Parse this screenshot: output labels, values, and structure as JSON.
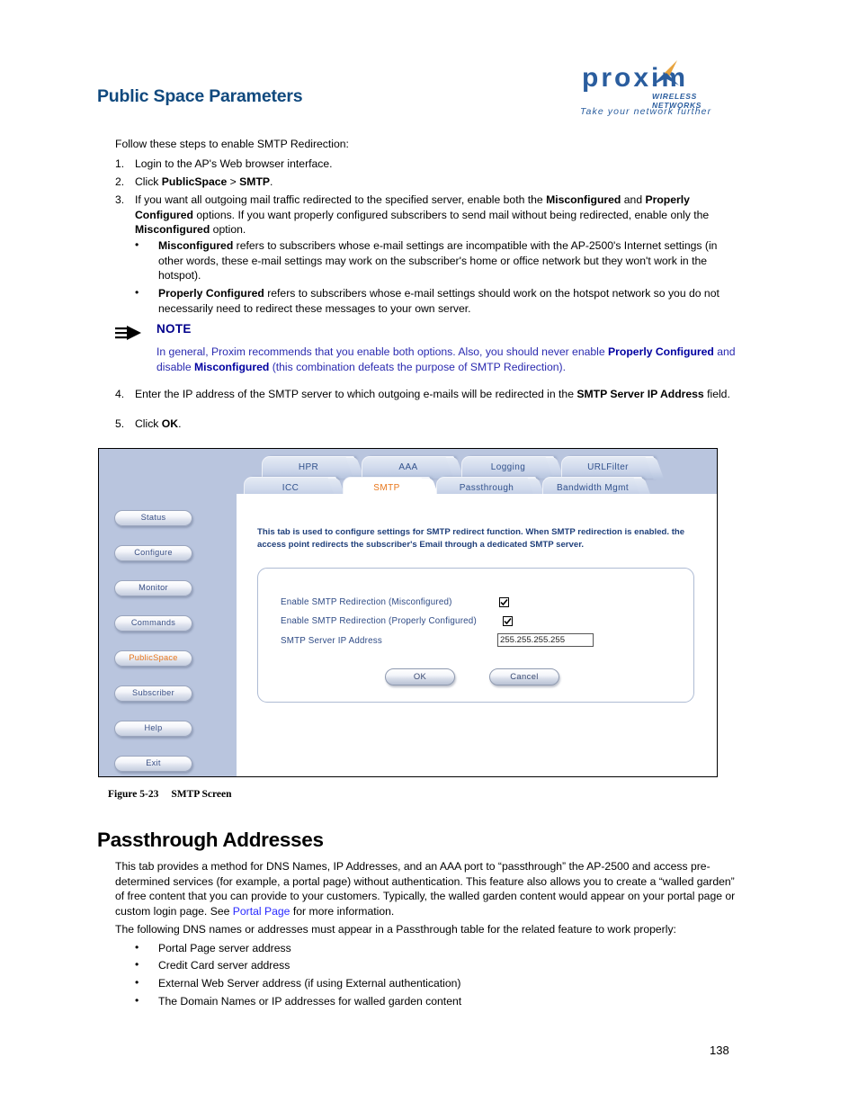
{
  "header": {
    "title": "Public Space Parameters",
    "logo": {
      "wordmark": "proxim",
      "subtitle": "WIRELESS NETWORKS",
      "tagline": "Take your network further",
      "brand_color": "#2a5d9e",
      "accent_color": "#e8a33d"
    }
  },
  "doc": {
    "intro": "Follow these steps to enable SMTP Redirection:",
    "steps": [
      {
        "num": "1.",
        "html": "Login to the AP's Web browser interface."
      },
      {
        "num": "2.",
        "html": "Click <b>PublicSpace</b> &gt; <b>SMTP</b>."
      },
      {
        "num": "3.",
        "html": "If you want all outgoing mail traffic redirected to the specified server, enable both the <b>Misconfigured</b> and <b>Properly Configured</b> options. If you want properly configured subscribers to send mail without being redirected, enable only the <b>Misconfigured</b> option."
      },
      {
        "num": "4.",
        "html": "Enter the IP address of the SMTP server to which outgoing e-mails will be redirected in the <b>SMTP Server IP Address</b> field."
      },
      {
        "num": "5.",
        "html": "Click <b>OK</b>."
      }
    ],
    "sub_bullets": [
      {
        "marker": "•",
        "html": "<b>Misconfigured</b> refers to subscribers whose e-mail settings are incompatible with the AP-2500's Internet settings (in other words, these e-mail settings may work on the subscriber's home or office network but they won't work in the hotspot)."
      },
      {
        "marker": "•",
        "html": "<b>Properly Configured</b> refers to subscribers whose e-mail settings should work on the hotspot network so you do not necessarily need to redirect these messages to your own server."
      }
    ],
    "note": {
      "label": "NOTE",
      "icon": "note-arrow-icon",
      "html": "In general, Proxim recommends that you enable both options. Also, you should never enable <b>Properly Configured</b> and disable <b>Misconfigured</b> (this combination defeats the purpose of SMTP Redirection).",
      "text_color": "#2a2ab0"
    }
  },
  "figure": {
    "caption_label": "Figure 5-23",
    "caption_text": "SMTP Screen",
    "sidebar": {
      "items": [
        {
          "label": "Status",
          "active": false
        },
        {
          "label": "Configure",
          "active": false
        },
        {
          "label": "Monitor",
          "active": false
        },
        {
          "label": "Commands",
          "active": false
        },
        {
          "label": "PublicSpace",
          "active": true
        },
        {
          "label": "Subscriber",
          "active": false
        },
        {
          "label": "Help",
          "active": false
        },
        {
          "label": "Exit",
          "active": false
        }
      ],
      "background_color": "#b9c5de",
      "active_color": "#e8761b"
    },
    "tabs_row1": [
      {
        "label": "HPR",
        "active": false
      },
      {
        "label": "AAA",
        "active": false
      },
      {
        "label": "Logging",
        "active": false
      },
      {
        "label": "URLFilter",
        "active": false
      }
    ],
    "tabs_row2": [
      {
        "label": "ICC",
        "active": false
      },
      {
        "label": "SMTP",
        "active": true
      },
      {
        "label": "Passthrough",
        "active": false
      },
      {
        "label": "Bandwidth Mgmt",
        "active": false
      }
    ],
    "description": "This tab is used to configure settings for SMTP redirect function. When SMTP redirection is enabled. the access point redirects the subscriber's Email through a dedicated SMTP server.",
    "form": {
      "fields": [
        {
          "label": "Enable SMTP Redirection (Misconfigured)",
          "type": "checkbox",
          "checked": true
        },
        {
          "label": "Enable SMTP Redirection (Properly Configured)",
          "type": "checkbox",
          "checked": true
        },
        {
          "label": "SMTP Server IP Address",
          "type": "text",
          "value": "255.255.255.255"
        }
      ],
      "ok_label": "OK",
      "cancel_label": "Cancel"
    }
  },
  "section": {
    "title": "Passthrough Addresses",
    "para1_html": "This tab provides a method for DNS Names, IP Addresses, and an AAA port to “passthrough” the AP-2500 and access pre-determined services (for example, a portal page) without authentication. This feature also allows you to create a “walled garden” of free content that you can provide to your customers. Typically, the walled garden content would appear on your portal page or custom login page. See <span class=\"link\">Portal Page</span> for more information.",
    "para2": "The following DNS names or addresses must appear in a Passthrough table for the related feature to work properly:",
    "bullets": [
      "Portal Page server address",
      "Credit Card server address",
      "External Web Server address (if using External authentication)",
      "The Domain Names or IP addresses for walled garden content"
    ],
    "link_color": "#2a2aff"
  },
  "footer": {
    "page_number": "138"
  }
}
